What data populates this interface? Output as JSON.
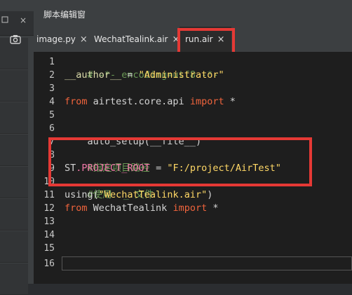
{
  "left_panel": {
    "close_icon": "×",
    "stack_icon": "stack-icon"
  },
  "header": {
    "title": "脚本编辑窗"
  },
  "tabs": [
    {
      "label": "image.py",
      "close": "×"
    },
    {
      "label": "WechatTealink.air",
      "close": "×"
    },
    {
      "label": "run.air",
      "close": "×",
      "active": true
    }
  ],
  "editor": {
    "line_numbers": [
      "1",
      "2",
      "3",
      "4",
      "5",
      "6",
      "7",
      "8",
      "9",
      "10",
      "11",
      "12",
      "13",
      "14",
      "15",
      "16"
    ],
    "lines": {
      "l1": "# -*- encoding=utf8 -*-",
      "l2_ident": "__author__",
      "l2_op": " = ",
      "l2_str": "\"Administrator\"",
      "l4_kw1": "from",
      "l4_mod": " airtest.core.api ",
      "l4_kw2": "import",
      "l4_star": " *",
      "l6": "auto_setup(__file__)",
      "l8": "#指定项目路径",
      "l9_a": "ST",
      "l9_b": ".PROJECT_ROOT",
      "l9_op": " = ",
      "l9_str": "\"F:/project/AirTest\"",
      "l10": "#使用  _ 文件",
      "l11_a": "using(",
      "l11_str": "\"WechatTealink.air\"",
      "l11_b": ")",
      "l12_kw1": "from",
      "l12_mod": " WechatTealink ",
      "l12_kw2": "import",
      "l12_star": " *"
    }
  },
  "colors": {
    "highlight_border": "#e53935",
    "editor_bg": "#1e1e1e",
    "comment": "#6a9955",
    "string": "#ffd866",
    "keyword": "#f0643c"
  }
}
